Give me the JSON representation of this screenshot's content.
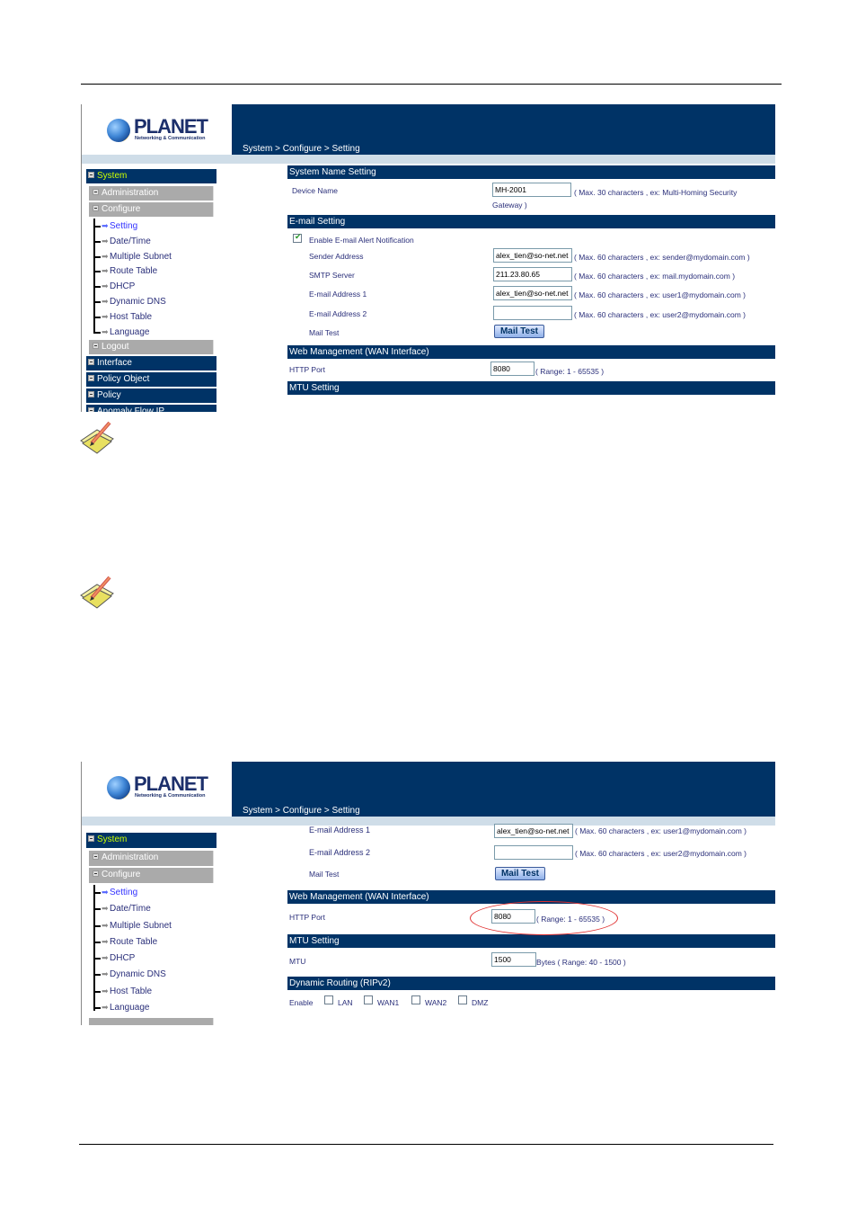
{
  "document": {
    "top_rule": true,
    "bottom_rule": true,
    "note_icons": [
      "notepad-pencil-icon",
      "notepad-pencil-icon"
    ]
  },
  "screenshot1": {
    "logo": {
      "brand": "PLANET",
      "tagline": "Networking & Communication"
    },
    "breadcrumb": "System > Configure > Setting",
    "sidebar": {
      "system": "System",
      "administration": "Administration",
      "configure": "Configure",
      "items": [
        {
          "label": "Setting",
          "active": true
        },
        {
          "label": "Date/Time"
        },
        {
          "label": "Multiple Subnet"
        },
        {
          "label": "Route Table"
        },
        {
          "label": "DHCP"
        },
        {
          "label": "Dynamic DNS"
        },
        {
          "label": "Host Table"
        },
        {
          "label": "Language"
        }
      ],
      "logout": "Logout",
      "groups": [
        "Interface",
        "Policy Object",
        "Policy",
        "Anomaly Flow IP"
      ]
    },
    "sections": {
      "system_name": {
        "title": "System Name Setting",
        "device_name_label": "Device Name",
        "device_name_value": "MH-2001",
        "device_name_hint": "( Max. 30 characters , ex: Multi-Homing Security",
        "device_name_hint2": "Gateway )"
      },
      "email": {
        "title": "E-mail Setting",
        "enable_label": "Enable E-mail Alert Notification",
        "enable_checked": true,
        "sender_label": "Sender Address",
        "sender_value": "alex_tien@so-net.net",
        "sender_hint": "( Max. 60 characters , ex: sender@mydomain.com )",
        "smtp_label": "SMTP Server",
        "smtp_value": "211.23.80.65",
        "smtp_hint": "( Max. 60 characters , ex: mail.mydomain.com )",
        "addr1_label": "E-mail Address 1",
        "addr1_value": "alex_tien@so-net.net",
        "addr1_hint": "( Max. 60 characters , ex: user1@mydomain.com )",
        "addr2_label": "E-mail Address 2",
        "addr2_value": "",
        "addr2_hint": "( Max. 60 characters , ex: user2@mydomain.com )",
        "mailtest_label": "Mail Test",
        "mailtest_button": "Mail Test"
      },
      "web": {
        "title": "Web Management (WAN Interface)",
        "http_label": "HTTP Port",
        "http_value": "8080",
        "http_hint": "( Range: 1 - 65535 )"
      },
      "mtu": {
        "title": "MTU Setting"
      }
    }
  },
  "screenshot2": {
    "logo": {
      "brand": "PLANET",
      "tagline": "Networking & Communication"
    },
    "breadcrumb": "System > Configure > Setting",
    "sidebar": {
      "system": "System",
      "administration": "Administration",
      "configure": "Configure",
      "items": [
        {
          "label": "Setting",
          "active": true
        },
        {
          "label": "Date/Time"
        },
        {
          "label": "Multiple Subnet"
        },
        {
          "label": "Route Table"
        },
        {
          "label": "DHCP"
        },
        {
          "label": "Dynamic DNS"
        },
        {
          "label": "Host Table"
        },
        {
          "label": "Language"
        }
      ]
    },
    "sections": {
      "email": {
        "addr1_label": "E-mail Address 1",
        "addr1_value": "alex_tien@so-net.net",
        "addr1_hint": "( Max. 60 characters , ex: user1@mydomain.com )",
        "addr2_label": "E-mail Address 2",
        "addr2_value": "",
        "addr2_hint": "( Max. 60 characters , ex: user2@mydomain.com )",
        "mailtest_label": "Mail Test",
        "mailtest_button": "Mail Test"
      },
      "web": {
        "title": "Web Management (WAN Interface)",
        "http_label": "HTTP Port",
        "http_value": "8080",
        "http_hint": "( Range: 1 - 65535 )",
        "highlight": "red-ellipse"
      },
      "mtu": {
        "title": "MTU Setting",
        "mtu_label": "MTU",
        "mtu_value": "1500",
        "mtu_hint": "Bytes ( Range: 40 - 1500 )"
      },
      "rip": {
        "title": "Dynamic Routing (RIPv2)",
        "enable_label": "Enable",
        "options": [
          {
            "label": "LAN",
            "checked": false
          },
          {
            "label": "WAN1",
            "checked": false
          },
          {
            "label": "WAN2",
            "checked": false
          },
          {
            "label": "DMZ",
            "checked": false
          }
        ]
      }
    }
  }
}
